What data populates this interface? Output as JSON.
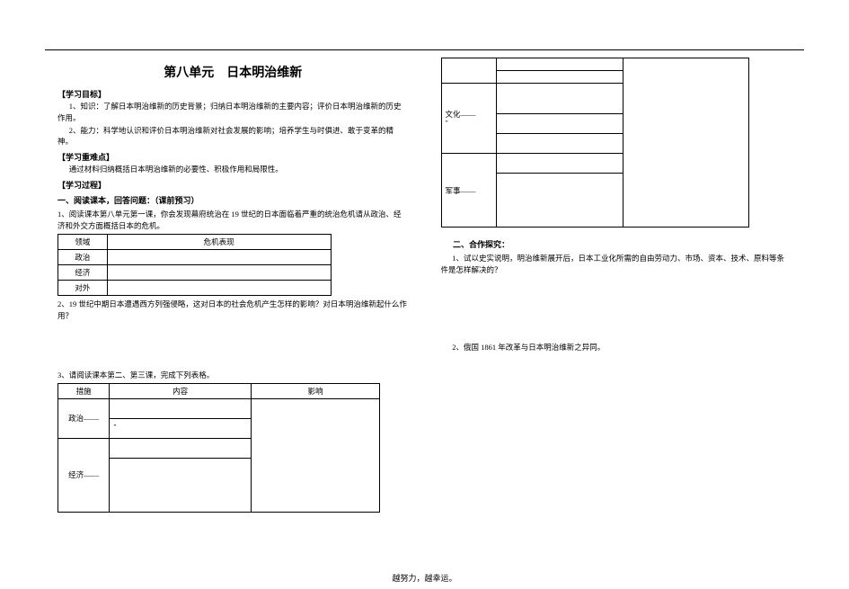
{
  "title": "第八单元　日本明治维新",
  "left": {
    "objectives_head": "【学习目标】",
    "obj1": "1、知识：了解日本明治维新的历史背景；归纳日本明治维新的主要内容；评价日本明治维新的历史作用。",
    "obj2": "2、能力：科学地认识和评价日本明治维新对社会发展的影响；培养学生与时俱进、敢于变革的精神。",
    "difficult_head": "【学习重难点】",
    "difficult": "通过材料归纳概括日本明治维新的必要性、积极作用和局限性。",
    "process_head": "【学习过程】",
    "section1": "一、阅读课本，回答问题：（课前预习）",
    "q1": "1、阅读课本第八单元第一课，你会发现幕府统治在 19 世纪的日本面临着严重的统治危机请从政治、经济和外交方面概括日本的危机。",
    "table1": {
      "h1": "领域",
      "h2": "危机表现",
      "rows": [
        "政治",
        "经济",
        "对外"
      ]
    },
    "q2": "2、19 世纪中期日本遭遇西方列强侵略，这对日本的社会危机产生怎样的影响？对日本明治维新起什么作用？",
    "q3": "3、请阅读课本第二、第三课，完成下列表格。",
    "table2": {
      "h1": "措施",
      "h2": "内容",
      "h3": "影响",
      "row_politics": "政治——",
      "row_economy": "经济——",
      "quote_mark": "”"
    }
  },
  "right": {
    "row_culture": "文化——",
    "row_military": "军事——",
    "quote_mark": "”",
    "section2": "二、合作探究：",
    "q1": "1、试以史实说明，明治维新展开后，日本工业化所需的自由劳动力、市场、资本、技术、原料等条件是怎样解决的？",
    "q2": "2、俄国 1861 年改革与日本明治维新之异同。"
  },
  "footer": "越努力，越幸运。"
}
